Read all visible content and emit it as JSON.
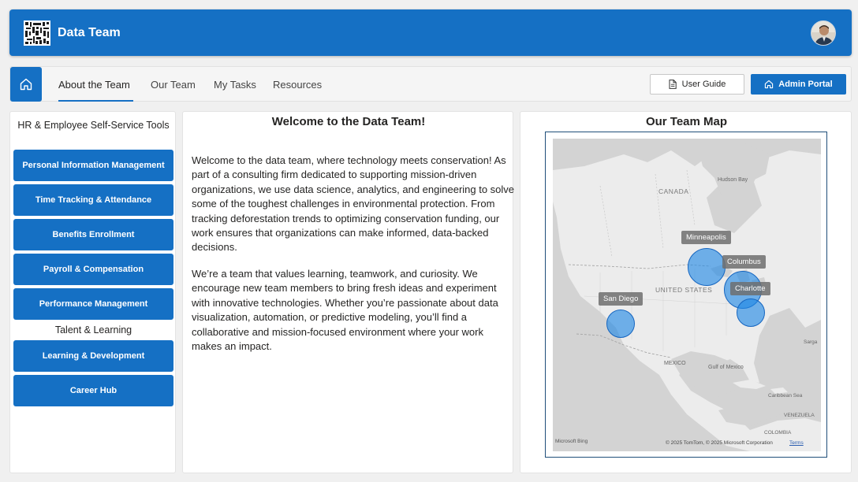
{
  "header": {
    "title": "Data Team"
  },
  "nav": {
    "tabs": [
      {
        "label": "About the Team"
      },
      {
        "label": "Our Team"
      },
      {
        "label": "My Tasks"
      },
      {
        "label": "Resources"
      }
    ],
    "user_guide_label": "User Guide",
    "admin_portal_label": "Admin Portal"
  },
  "sidebar": {
    "heading": "HR & Employee Self-Service Tools",
    "items": [
      {
        "label": "Personal Information Management"
      },
      {
        "label": "Time Tracking & Attendance"
      },
      {
        "label": "Benefits Enrollment"
      },
      {
        "label": "Payroll & Compensation"
      },
      {
        "label": "Performance Management"
      }
    ],
    "section2_heading": "Talent & Learning",
    "items2": [
      {
        "label": "Learning & Development"
      },
      {
        "label": "Career Hub"
      }
    ]
  },
  "main": {
    "title": "Welcome to the Data Team!",
    "paragraphs": [
      "Welcome to the data team, where technology meets conservation! As part of a consulting firm dedicated to supporting mission-driven organizations, we use data science, analytics, and engineering to solve some of the toughest challenges in environmental protection. From tracking deforestation trends to optimizing conservation funding, our work ensures that organizations can make informed, data-backed decisions.",
      "We’re a team that values learning, teamwork, and curiosity. We encourage new team members to bring fresh ideas and experiment with innovative technologies. Whether you’re passionate about data visualization, automation, or predictive modeling, you’ll find a collaborative and mission-focused environment where your work makes an impact."
    ]
  },
  "map": {
    "title": "Our Team Map",
    "cities": [
      {
        "label": "Minneapolis"
      },
      {
        "label": "Columbus"
      },
      {
        "label": "Charlotte"
      },
      {
        "label": "San Diego"
      }
    ],
    "region_labels": {
      "canada": "CANADA",
      "hudson_bay": "Hudson Bay",
      "united_states": "UNITED STATES",
      "mexico": "MEXICO",
      "gulf": "Gulf of Mexico",
      "caribbean": "Caribbean Sea",
      "venezuela": "VENEZUELA",
      "colombia": "COLOMBIA",
      "sargasso": "Sarga"
    },
    "attribution": "© 2025 TomTom, © 2025 Microsoft Corporation",
    "terms": "Terms",
    "provider": "Microsoft Bing"
  },
  "colors": {
    "primary": "#1570c4",
    "bubble": "#1e88e5",
    "background": "#f0f0f0"
  },
  "icons": {
    "home": "home-icon",
    "document": "document-icon",
    "avatar": "user-avatar"
  }
}
